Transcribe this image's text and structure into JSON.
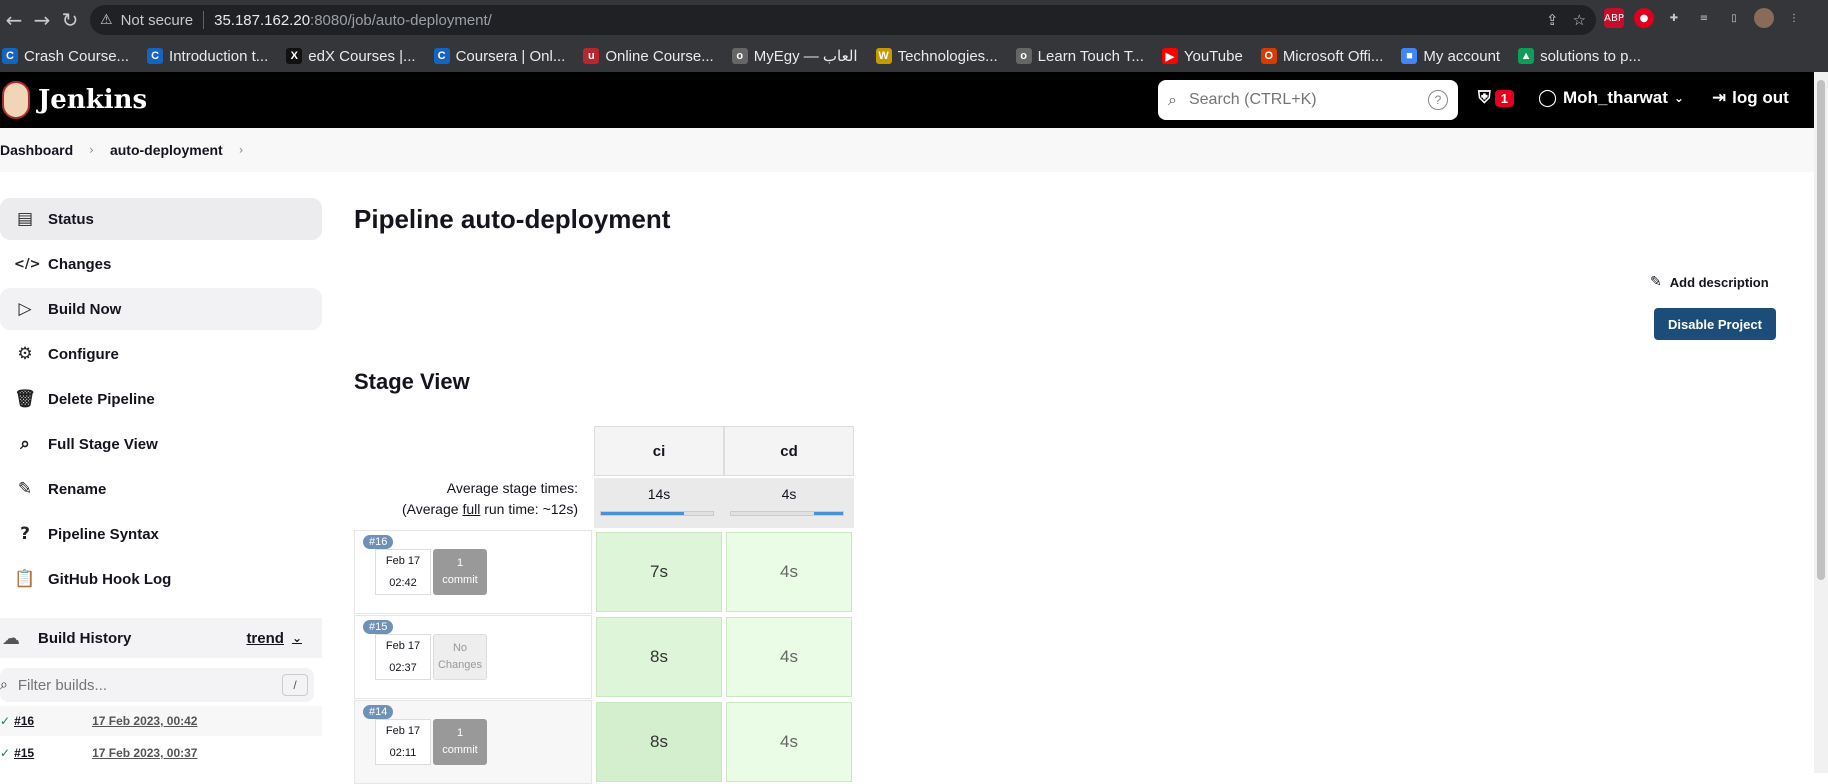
{
  "browser": {
    "security": "Not secure",
    "url_host": "35.187.162.20",
    "url_path": ":8080/job/auto-deployment/",
    "extensions": {
      "abp": "ABP"
    }
  },
  "bookmarks": [
    {
      "label": "Crash Course...",
      "color": "#1565c0",
      "glyph": "C"
    },
    {
      "label": "Introduction t...",
      "color": "#1565c0",
      "glyph": "C"
    },
    {
      "label": "edX Courses |...",
      "color": "#111111",
      "glyph": "X"
    },
    {
      "label": "Coursera | Onl...",
      "color": "#1565c0",
      "glyph": "C"
    },
    {
      "label": "Online Course...",
      "color": "#b7282e",
      "glyph": "u"
    },
    {
      "label": "MyEgy — العاب",
      "color": "#666666",
      "glyph": "o"
    },
    {
      "label": "Technologies...",
      "color": "#c99a00",
      "glyph": "W"
    },
    {
      "label": "Learn Touch T...",
      "color": "#666666",
      "glyph": "o"
    },
    {
      "label": "YouTube",
      "color": "#ff0000",
      "glyph": "▶"
    },
    {
      "label": "Microsoft Offi...",
      "color": "#d83b01",
      "glyph": "O"
    },
    {
      "label": "My account",
      "color": "#4285f4",
      "glyph": "■"
    },
    {
      "label": "solutions to p...",
      "color": "#0f9d58",
      "glyph": "▲"
    }
  ],
  "header": {
    "title": "Jenkins",
    "search_placeholder": "Search (CTRL+K)",
    "alert_count": "1",
    "username": "Moh_tharwat",
    "logout": "log out"
  },
  "breadcrumb": {
    "dashboard": "Dashboard",
    "job": "auto-deployment"
  },
  "sidebar": {
    "items": [
      {
        "label": "Status",
        "icon": "▤"
      },
      {
        "label": "Changes",
        "icon": "</>"
      },
      {
        "label": "Build Now",
        "icon": "▷"
      },
      {
        "label": "Configure",
        "icon": "⚙"
      },
      {
        "label": "Delete Pipeline",
        "icon": "🗑"
      },
      {
        "label": "Full Stage View",
        "icon": "⌕"
      },
      {
        "label": "Rename",
        "icon": "✎"
      },
      {
        "label": "Pipeline Syntax",
        "icon": "?"
      },
      {
        "label": "GitHub Hook Log",
        "icon": "📋"
      }
    ]
  },
  "build_history": {
    "title": "Build History",
    "trend": "trend",
    "filter_placeholder": "Filter builds...",
    "filter_shortcut": "/",
    "builds": [
      {
        "number": "#16",
        "date": "17 Feb 2023, 00:42"
      },
      {
        "number": "#15",
        "date": "17 Feb 2023, 00:37"
      }
    ]
  },
  "main": {
    "title": "Pipeline auto-deployment",
    "add_description": "Add description",
    "disable_button": "Disable Project",
    "stage_view_title": "Stage View"
  },
  "stage_view": {
    "stages": [
      "ci",
      "cd"
    ],
    "avg_label_1": "Average stage times:",
    "avg_label_2a": "(Average ",
    "avg_label_2b": "full",
    "avg_label_2c": " run time: ~12s)",
    "avg_times": [
      "14s",
      "4s"
    ],
    "avg_bar": [
      {
        "start": 0.0,
        "fill": 0.74
      },
      {
        "start": 0.74,
        "fill": 0.26
      }
    ],
    "runs": [
      {
        "number": "#16",
        "date": "Feb 17",
        "time": "02:42",
        "commit_line1": "1",
        "commit_line2": "commit",
        "has_changes": true,
        "durations": [
          "7s",
          "4s"
        ]
      },
      {
        "number": "#15",
        "date": "Feb 17",
        "time": "02:37",
        "commit_line1": "No",
        "commit_line2": "Changes",
        "has_changes": false,
        "durations": [
          "8s",
          "4s"
        ]
      },
      {
        "number": "#14",
        "date": "Feb 17",
        "time": "02:11",
        "commit_line1": "1",
        "commit_line2": "commit",
        "has_changes": true,
        "durations": [
          "8s",
          "4s"
        ]
      }
    ]
  }
}
